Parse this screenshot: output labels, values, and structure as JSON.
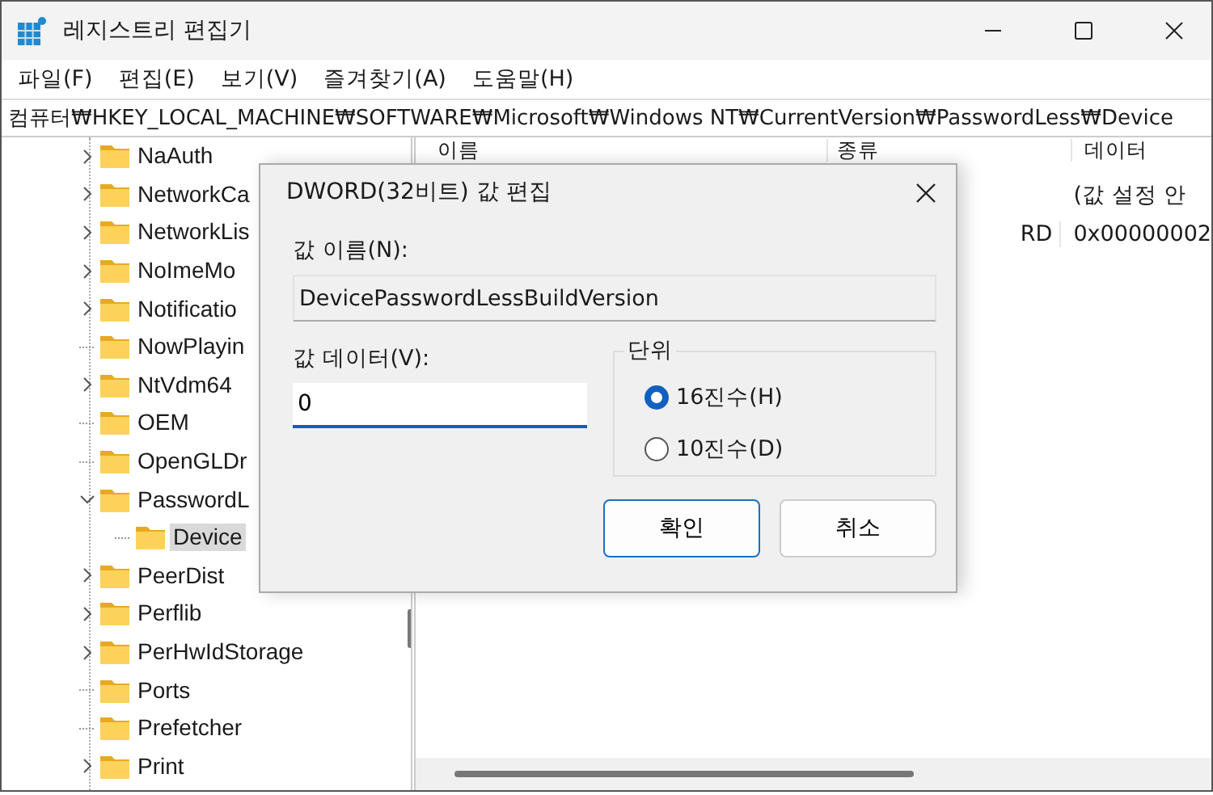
{
  "window": {
    "title": "레지스트리 편집기"
  },
  "menu": [
    "파일(F)",
    "편집(E)",
    "보기(V)",
    "즐겨찾기(A)",
    "도움말(H)"
  ],
  "address": "컴퓨터₩HKEY_LOCAL_MACHINE₩SOFTWARE₩Microsoft₩Windows NT₩CurrentVersion₩PasswordLess₩Device",
  "tree": [
    {
      "label": "NaAuth",
      "kind": "collapsed",
      "selected": false
    },
    {
      "label": "NetworkCa",
      "kind": "collapsed",
      "selected": false
    },
    {
      "label": "NetworkLis",
      "kind": "collapsed",
      "selected": false
    },
    {
      "label": "NoImeMo",
      "kind": "collapsed",
      "selected": false
    },
    {
      "label": "Notificatio",
      "kind": "collapsed",
      "selected": false
    },
    {
      "label": "NowPlayin",
      "kind": "leaf",
      "selected": false
    },
    {
      "label": "NtVdm64",
      "kind": "collapsed",
      "selected": false
    },
    {
      "label": "OEM",
      "kind": "leaf",
      "selected": false
    },
    {
      "label": "OpenGLDr",
      "kind": "leaf",
      "selected": false
    },
    {
      "label": "PasswordL",
      "kind": "expanded",
      "selected": false,
      "children": [
        {
          "label": "Device",
          "kind": "leaf",
          "selected": true
        }
      ]
    },
    {
      "label": "PeerDist",
      "kind": "collapsed",
      "selected": false
    },
    {
      "label": "Perflib",
      "kind": "collapsed",
      "selected": false
    },
    {
      "label": "PerHwIdStorage",
      "kind": "collapsed",
      "selected": false
    },
    {
      "label": "Ports",
      "kind": "leaf",
      "selected": false
    },
    {
      "label": "Prefetcher",
      "kind": "leaf",
      "selected": false
    },
    {
      "label": "Print",
      "kind": "collapsed",
      "selected": false
    }
  ],
  "values": {
    "columns": [
      "이름",
      "종류",
      "데이터"
    ],
    "rows": [
      {
        "type": "",
        "data": "(값 설정 안"
      },
      {
        "type": "RD",
        "data": "0x00000002"
      }
    ]
  },
  "dialog": {
    "title": "DWORD(32비트) 값 편집",
    "name_label": "값 이름(N):",
    "name_value": "DevicePasswordLessBuildVersion",
    "data_label": "값 데이터(V):",
    "data_value": "0",
    "base_label": "단위",
    "bases": [
      {
        "label": "16진수(H)",
        "selected": true
      },
      {
        "label": "10진수(D)",
        "selected": false
      }
    ],
    "buttons": [
      {
        "label": "확인",
        "default": true
      },
      {
        "label": "취소",
        "default": false
      }
    ]
  }
}
